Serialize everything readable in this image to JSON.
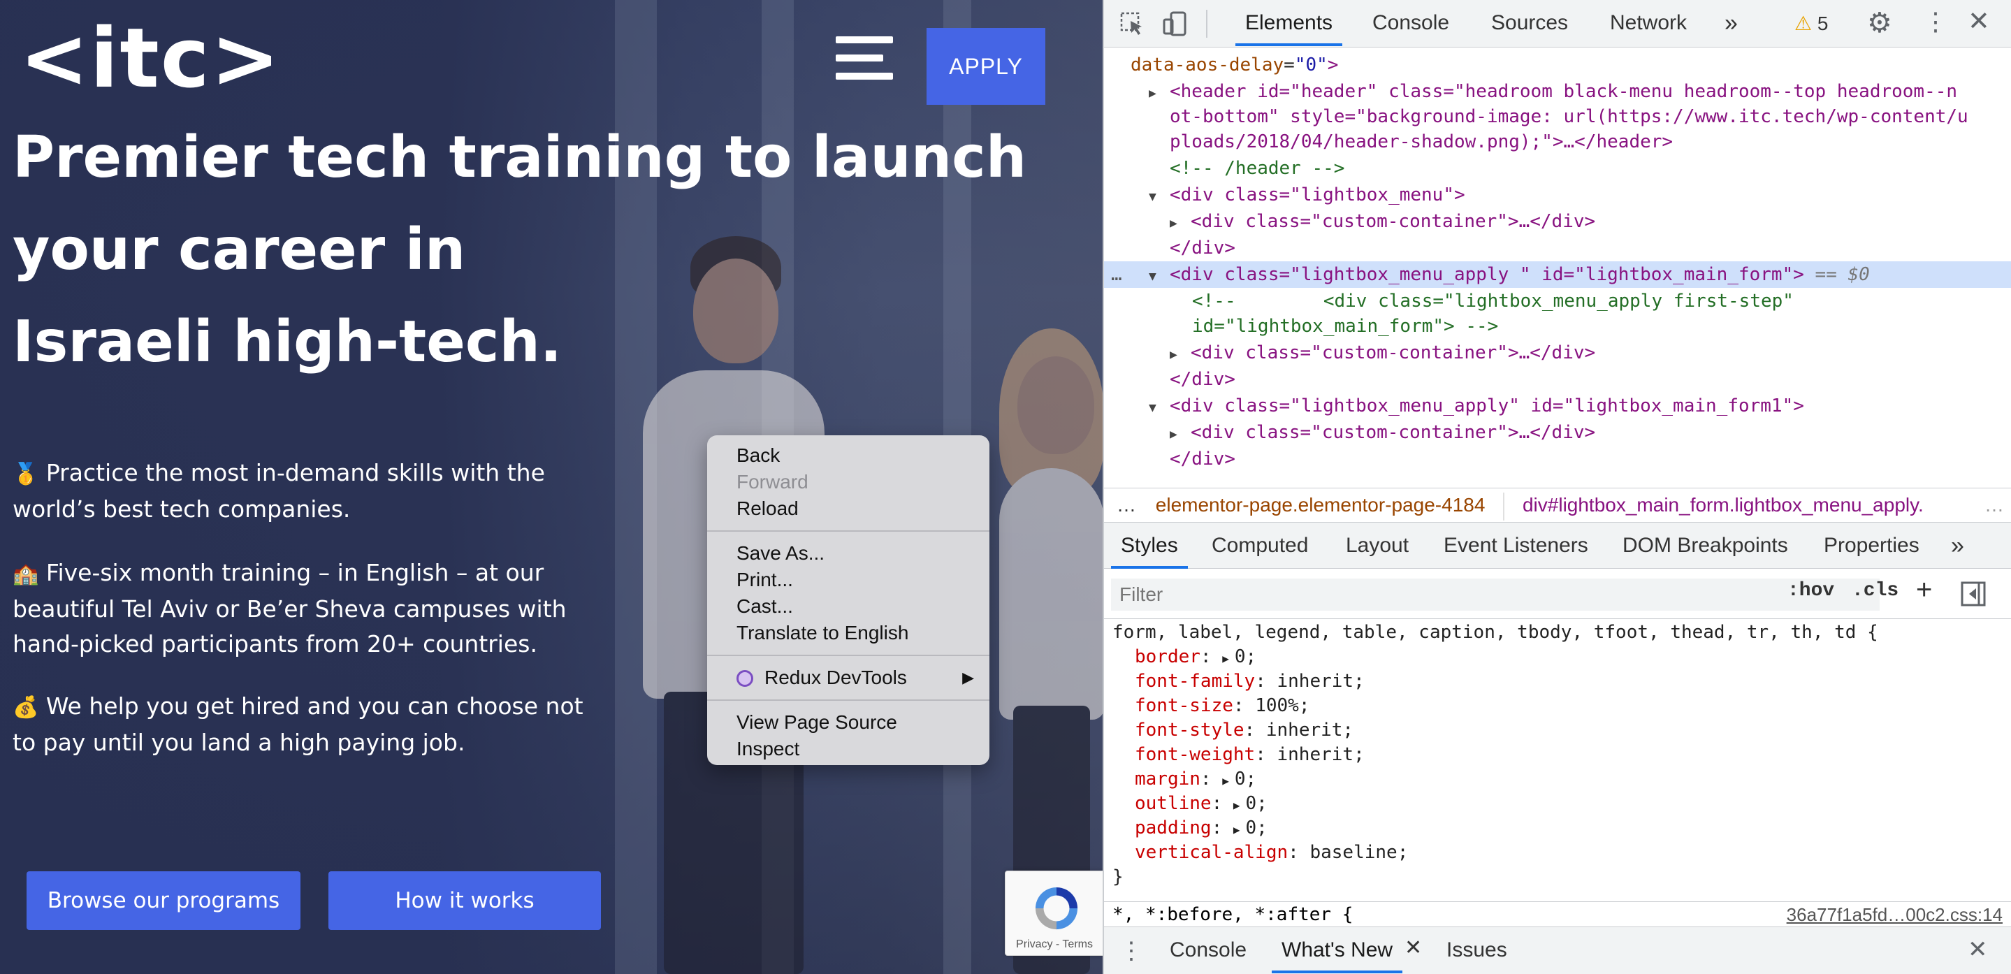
{
  "site": {
    "logo": "<itc>",
    "apply_label": "APPLY",
    "hero_title_lines": [
      "Premier tech training to launch",
      "your career in",
      "Israeli high-tech."
    ],
    "bullets": [
      {
        "emoji": "🥇",
        "lines": [
          "Practice the most in-demand skills with the",
          "world’s best tech companies."
        ]
      },
      {
        "emoji": "🏫",
        "lines": [
          "Five-six month training – in English –  at our",
          "beautiful Tel Aviv or Be’er Sheva campuses with",
          "hand-picked participants from 20+ countries."
        ]
      },
      {
        "emoji": "💰",
        "lines": [
          "We help you get hired and you can choose not",
          "to pay until you land a high paying job."
        ]
      }
    ],
    "cta_browse": "Browse our programs",
    "cta_how": "How it works",
    "recaptcha_text": "Privacy - Terms"
  },
  "context_menu": {
    "items": [
      "Back",
      "Forward",
      "Reload",
      "Save As...",
      "Print...",
      "Cast...",
      "Translate to English",
      "Redux DevTools",
      "View Page Source",
      "Inspect"
    ],
    "disabled": [
      "Forward"
    ]
  },
  "devtools": {
    "tabs": [
      "Elements",
      "Console",
      "Sources",
      "Network"
    ],
    "more_tabs": "»",
    "warning_count": "5",
    "dom_lines": {
      "l0_attr": "data-aos-delay",
      "l0_val": "\"0\"",
      "header_1": "<header id=\"header\" class=\"headroom black-menu headroom--top headroom--n",
      "header_2": "ot-bottom\" style=\"background-image: url(https://www.itc.tech/wp-content/u",
      "header_3": "ploads/2018/04/header-shadow.png);\">…</header>",
      "comment_header": "<!-- /header -->",
      "lightbox_menu": "<div class=\"lightbox_menu\">",
      "custom_container": "<div class=\"custom-container\">…</div>",
      "close_div": "</div>",
      "sel_open": "<div class=\"lightbox_menu_apply \" id=\"lightbox_main_form\">",
      "sel_suffix": " == $0",
      "comment_1": "<!--        <div class=\"lightbox_menu_apply first-step\"",
      "comment_2": "id=\"lightbox_main_form\"> -->",
      "form1_open": "<div class=\"lightbox_menu_apply\" id=\"lightbox_main_form1\">"
    },
    "breadcrumbs": [
      "elementor-page.elementor-page-4184",
      "div#lightbox_main_form.lightbox_menu_apply."
    ],
    "style_tabs": [
      "Styles",
      "Computed",
      "Layout",
      "Event Listeners",
      "DOM Breakpoints",
      "Properties"
    ],
    "filter_placeholder": "Filter",
    "hov": ":hov",
    "cls": ".cls",
    "selector_line": "form, label, legend, table, caption, tbody, tfoot, thead, tr, th, td {",
    "declarations": [
      {
        "prop": "border",
        "val": "0;",
        "expandable": true
      },
      {
        "prop": "font-family",
        "val": "inherit;",
        "expandable": false
      },
      {
        "prop": "font-size",
        "val": "100%;",
        "expandable": false
      },
      {
        "prop": "font-style",
        "val": "inherit;",
        "expandable": false
      },
      {
        "prop": "font-weight",
        "val": "inherit;",
        "expandable": false
      },
      {
        "prop": "margin",
        "val": "0;",
        "expandable": true
      },
      {
        "prop": "outline",
        "val": "0;",
        "expandable": true
      },
      {
        "prop": "padding",
        "val": "0;",
        "expandable": true
      },
      {
        "prop": "vertical-align",
        "val": "baseline;",
        "expandable": false
      }
    ],
    "rule_close": "}",
    "next_selector": "*, *:before, *:after {",
    "next_source": "36a77f1a5fd…00c2.css:14",
    "drawer_tabs": [
      "Console",
      "What's New",
      "Issues"
    ]
  }
}
